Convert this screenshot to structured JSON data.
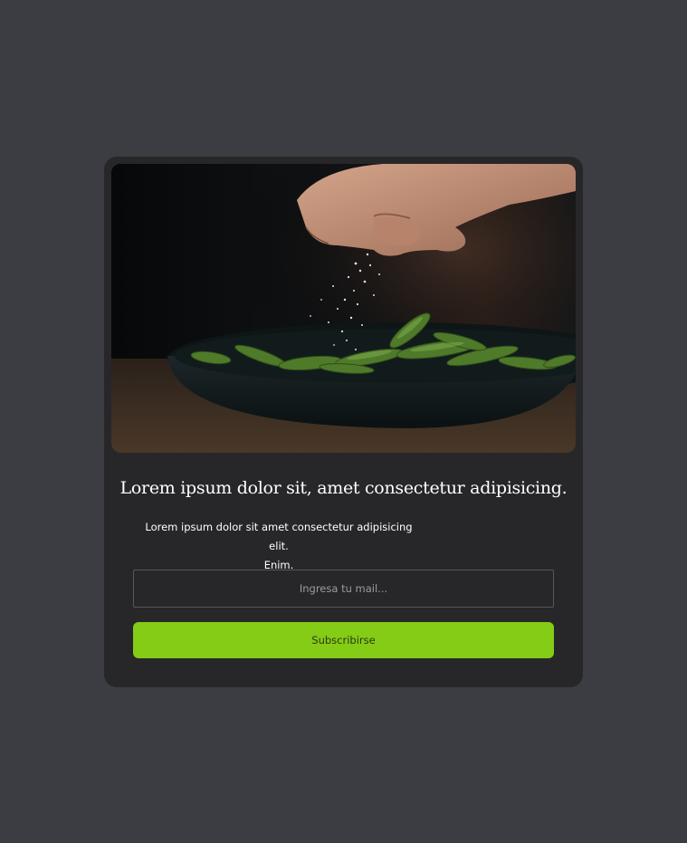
{
  "card": {
    "image_subject": "hand sprinkling salt over green edamame pods in a dark bowl",
    "title": "Lorem ipsum dolor sit, amet consectetur adipisicing.",
    "description_line1": "Lorem ipsum dolor sit amet consectetur adipisicing elit.",
    "description_line2": "Enim.",
    "email_placeholder": "Ingresa tu mail...",
    "email_value": "",
    "subscribe_label": "Subscribirse"
  },
  "colors": {
    "page_background": "#3c3d42",
    "card_background": "#27272a",
    "accent": "#84cc16"
  }
}
